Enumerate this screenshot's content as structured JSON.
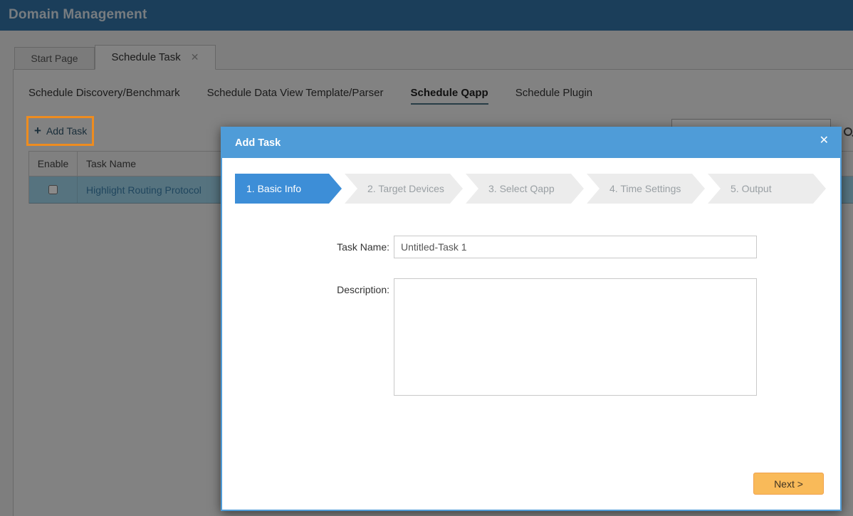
{
  "app": {
    "title": "Domain Management"
  },
  "tabs": {
    "items": [
      {
        "label": "Start Page",
        "active": false
      },
      {
        "label": "Schedule Task",
        "active": true,
        "close_glyph": "✕"
      }
    ]
  },
  "subnav": {
    "items": [
      {
        "label": "Schedule Discovery/Benchmark",
        "active": false
      },
      {
        "label": "Schedule Data View Template/Parser",
        "active": false
      },
      {
        "label": "Schedule Qapp",
        "active": true
      },
      {
        "label": "Schedule Plugin",
        "active": false
      }
    ]
  },
  "toolbar": {
    "plus_glyph": "+",
    "add_task_label": "Add Task"
  },
  "search": {
    "value": "",
    "icon": "search-icon"
  },
  "table": {
    "columns": [
      "Enable",
      "Task Name"
    ],
    "rows": [
      {
        "enabled": false,
        "task_name": "Highlight Routing Protocol",
        "selected": true
      }
    ]
  },
  "annotation": {
    "highlight_color": "#ee8c1f",
    "target": "Add Task button"
  },
  "modal": {
    "title": "Add Task",
    "close_glyph": "✕",
    "steps": [
      {
        "label": "1. Basic Info",
        "active": true
      },
      {
        "label": "2. Target Devices",
        "active": false
      },
      {
        "label": "3. Select Qapp",
        "active": false
      },
      {
        "label": "4. Time Settings",
        "active": false
      },
      {
        "label": "5. Output",
        "active": false
      }
    ],
    "form": {
      "task_name_label": "Task Name:",
      "task_name_value": "Untitled-Task 1",
      "description_label": "Description:",
      "description_value": ""
    },
    "next_label": "Next >"
  },
  "colors": {
    "app_header": "#3273a6",
    "modal_blue": "#4f9cd8",
    "step_active_blue": "#3d8ed7",
    "selected_row": "#9fd4eb",
    "next_button": "#f9ba59",
    "annotation_orange": "#ee8c1f"
  }
}
